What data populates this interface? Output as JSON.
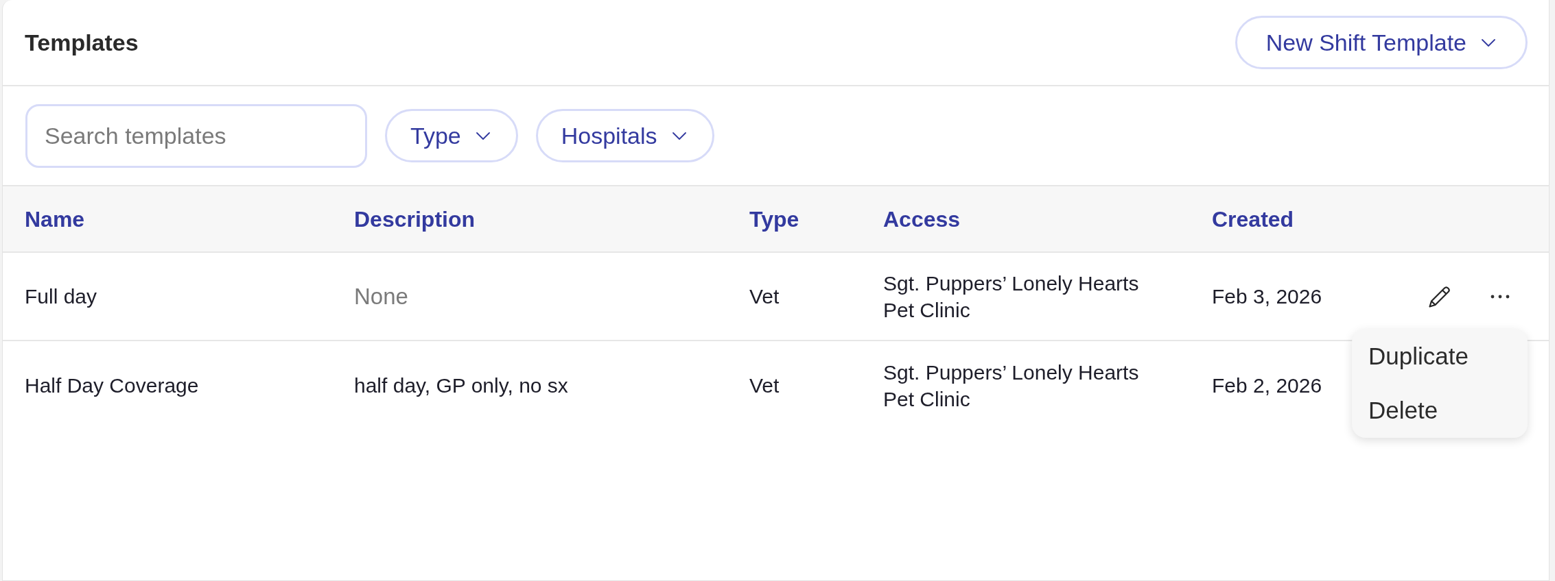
{
  "header": {
    "title": "Templates",
    "new_button": {
      "label": "New Shift Template"
    }
  },
  "filters": {
    "search": {
      "placeholder": "Search templates"
    },
    "dropdowns": [
      {
        "label": "Type"
      },
      {
        "label": "Hospitals"
      }
    ]
  },
  "table": {
    "columns": [
      "Name",
      "Description",
      "Type",
      "Access",
      "Created"
    ],
    "rows": [
      {
        "name": "Full day",
        "description": "None",
        "muted": true,
        "type": "Vet",
        "access": "Sgt. Puppers’ Lonely Hearts Pet Clinic",
        "created": "Feb 3, 2026",
        "menu_open": true
      },
      {
        "name": "Half Day Coverage",
        "description": "half day, GP only, no sx",
        "muted": false,
        "type": "Vet",
        "access": "Sgt. Puppers’ Lonely Hearts Pet Clinic",
        "created": "Feb 2, 2026",
        "menu_open": false
      }
    ]
  },
  "row_menu": {
    "items": [
      "Duplicate",
      "Delete"
    ]
  }
}
